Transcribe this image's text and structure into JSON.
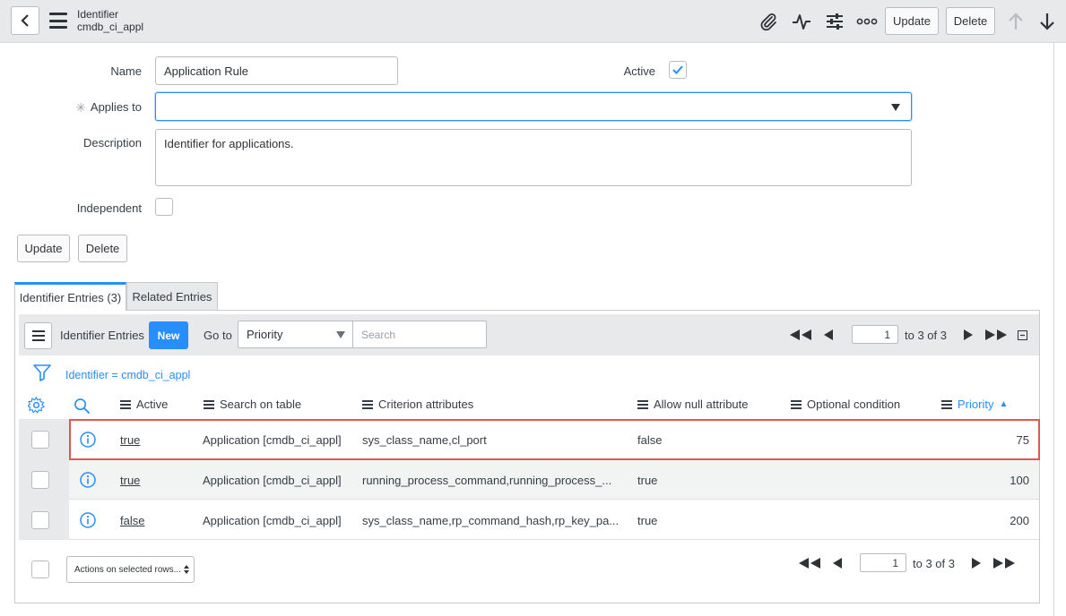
{
  "header": {
    "title": "Identifier",
    "subtitle": "cmdb_ci_appl",
    "update_label": "Update",
    "delete_label": "Delete"
  },
  "form": {
    "name_label": "Name",
    "name_value": "Application Rule",
    "active_label": "Active",
    "applies_label": "Applies to",
    "required_mark": "✳",
    "applies_value": "",
    "description_label": "Description",
    "description_value": "Identifier for applications.",
    "independent_label": "Independent",
    "update_label": "Update",
    "delete_label": "Delete"
  },
  "tabs": [
    {
      "label": "Identifier Entries (3)",
      "active": true
    },
    {
      "label": "Related Entries",
      "active": false
    }
  ],
  "list": {
    "title": "Identifier Entries",
    "new_label": "New",
    "goto_label": "Go to",
    "goto_select": "Priority",
    "search_placeholder": "Search",
    "page_value": "1",
    "page_range": "to 3 of 3",
    "filter_text": "Identifier = cmdb_ci_appl",
    "columns": [
      "Active",
      "Search on table",
      "Criterion attributes",
      "Allow null attribute",
      "Optional condition",
      "Priority"
    ],
    "sort_mark": "▲",
    "rows": [
      {
        "active": "true",
        "table": "Application [cmdb_ci_appl]",
        "criterion": "sys_class_name,cl_port",
        "allow_null": "false",
        "condition": "",
        "priority": "75"
      },
      {
        "active": "true",
        "table": "Application [cmdb_ci_appl]",
        "criterion": "running_process_command,running_process_...",
        "allow_null": "true",
        "condition": "",
        "priority": "100"
      },
      {
        "active": "false",
        "table": "Application [cmdb_ci_appl]",
        "criterion": "sys_class_name,rp_command_hash,rp_key_pa...",
        "allow_null": "true",
        "condition": "",
        "priority": "200"
      }
    ],
    "actions_label": "Actions on selected rows...",
    "footer_page_value": "1",
    "footer_page_range": "to 3 of 3"
  },
  "colors": {
    "accent": "#278efc",
    "highlight": "#e0574f",
    "topbar": "#e8e9ea"
  }
}
